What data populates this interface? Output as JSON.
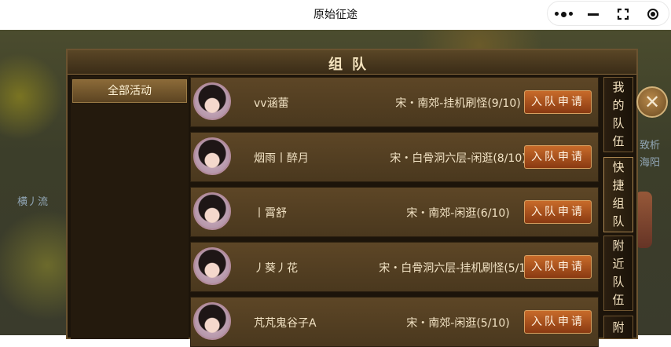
{
  "app_title": "原始征途",
  "capsule": {
    "more_icon": "more-dots-icon",
    "minimize_icon": "minus-icon",
    "exit_icon": "target-icon"
  },
  "background": {
    "text_left": "横丿流",
    "text_right_1": "致析",
    "text_right_2": "海阳"
  },
  "panel": {
    "title": "组队",
    "side_items": [
      "全部活动"
    ],
    "rows": [
      {
        "name": "vv涵蕾",
        "activity": "宋・南郊-挂机刷怪(9/10)",
        "action": "入队申请"
      },
      {
        "name": "烟雨丨醉月",
        "activity": "宋・白骨洞六层-闲逛(8/10)",
        "action": "入队申请"
      },
      {
        "name": "丨霄舒",
        "activity": "宋・南郊-闲逛(6/10)",
        "action": "入队申请"
      },
      {
        "name": "丿葵丿花",
        "activity": "宋・白骨洞六层-挂机刷怪(5/10)",
        "action": "入队申请"
      },
      {
        "name": "芃芃鬼谷子A",
        "activity": "宋・南郊-闲逛(5/10)",
        "action": "入队申请"
      }
    ],
    "right_tabs": [
      {
        "label": [
          "我",
          "的",
          "队",
          "伍"
        ]
      },
      {
        "label": [
          "快",
          "捷",
          "组",
          "队"
        ]
      },
      {
        "label": [
          "附",
          "近",
          "队",
          "伍"
        ]
      },
      {
        "label": [
          "附"
        ]
      }
    ],
    "close_icon": "close-icon"
  }
}
